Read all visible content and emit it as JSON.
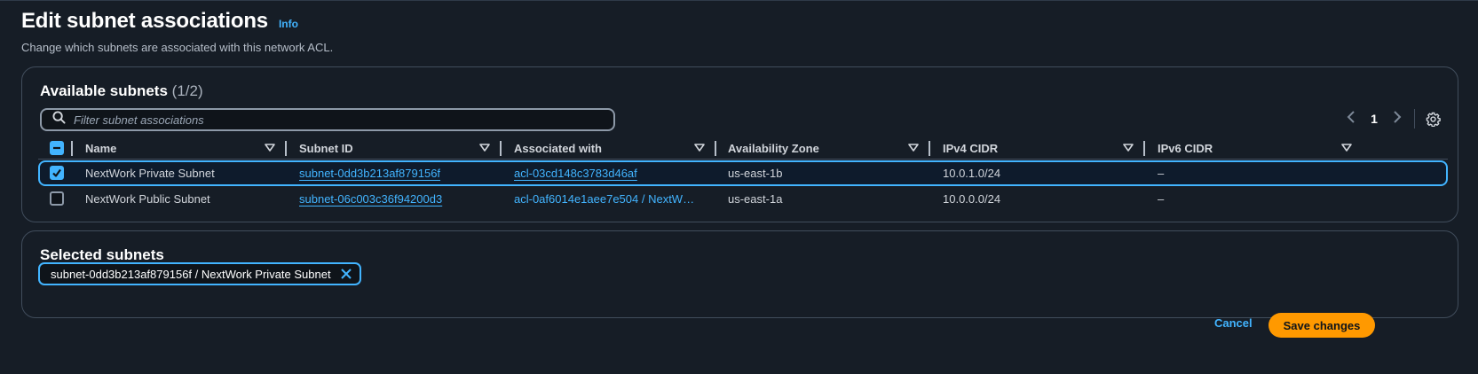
{
  "header": {
    "title": "Edit subnet associations",
    "info_label": "Info",
    "description": "Change which subnets are associated with this network ACL."
  },
  "available": {
    "heading": "Available subnets",
    "count": "(1/2)",
    "filter_placeholder": "Filter subnet associations",
    "page_number": "1",
    "columns": [
      "Name",
      "Subnet ID",
      "Associated with",
      "Availability Zone",
      "IPv4 CIDR",
      "IPv6 CIDR"
    ],
    "rows": [
      {
        "checked": true,
        "name": "NextWork Private Subnet",
        "subnet_id": "subnet-0dd3b213af879156f",
        "associated_with": "acl-03cd148c3783d46af",
        "az": "us-east-1b",
        "ipv4": "10.0.1.0/24",
        "ipv6": "–"
      },
      {
        "checked": false,
        "name": "NextWork Public Subnet",
        "subnet_id": "subnet-06c003c36f94200d3",
        "associated_with": "acl-0af6014e1aee7e504 / NextW…",
        "az": "us-east-1a",
        "ipv4": "10.0.0.0/24",
        "ipv6": "–"
      }
    ]
  },
  "selected": {
    "heading": "Selected subnets",
    "tokens": [
      "subnet-0dd3b213af879156f / NextWork Private Subnet"
    ]
  },
  "actions": {
    "cancel_label": "Cancel",
    "save_label": "Save changes"
  },
  "colors": {
    "background": "#161d26",
    "accent": "#42b4ff",
    "primary_button": "#ff9900",
    "border": "#414d5c"
  },
  "icons": [
    "search-icon",
    "chevron-left-icon",
    "chevron-right-icon",
    "gear-icon",
    "sort-caret-icon",
    "close-icon",
    "checkmark-icon",
    "indeterminate-icon"
  ]
}
